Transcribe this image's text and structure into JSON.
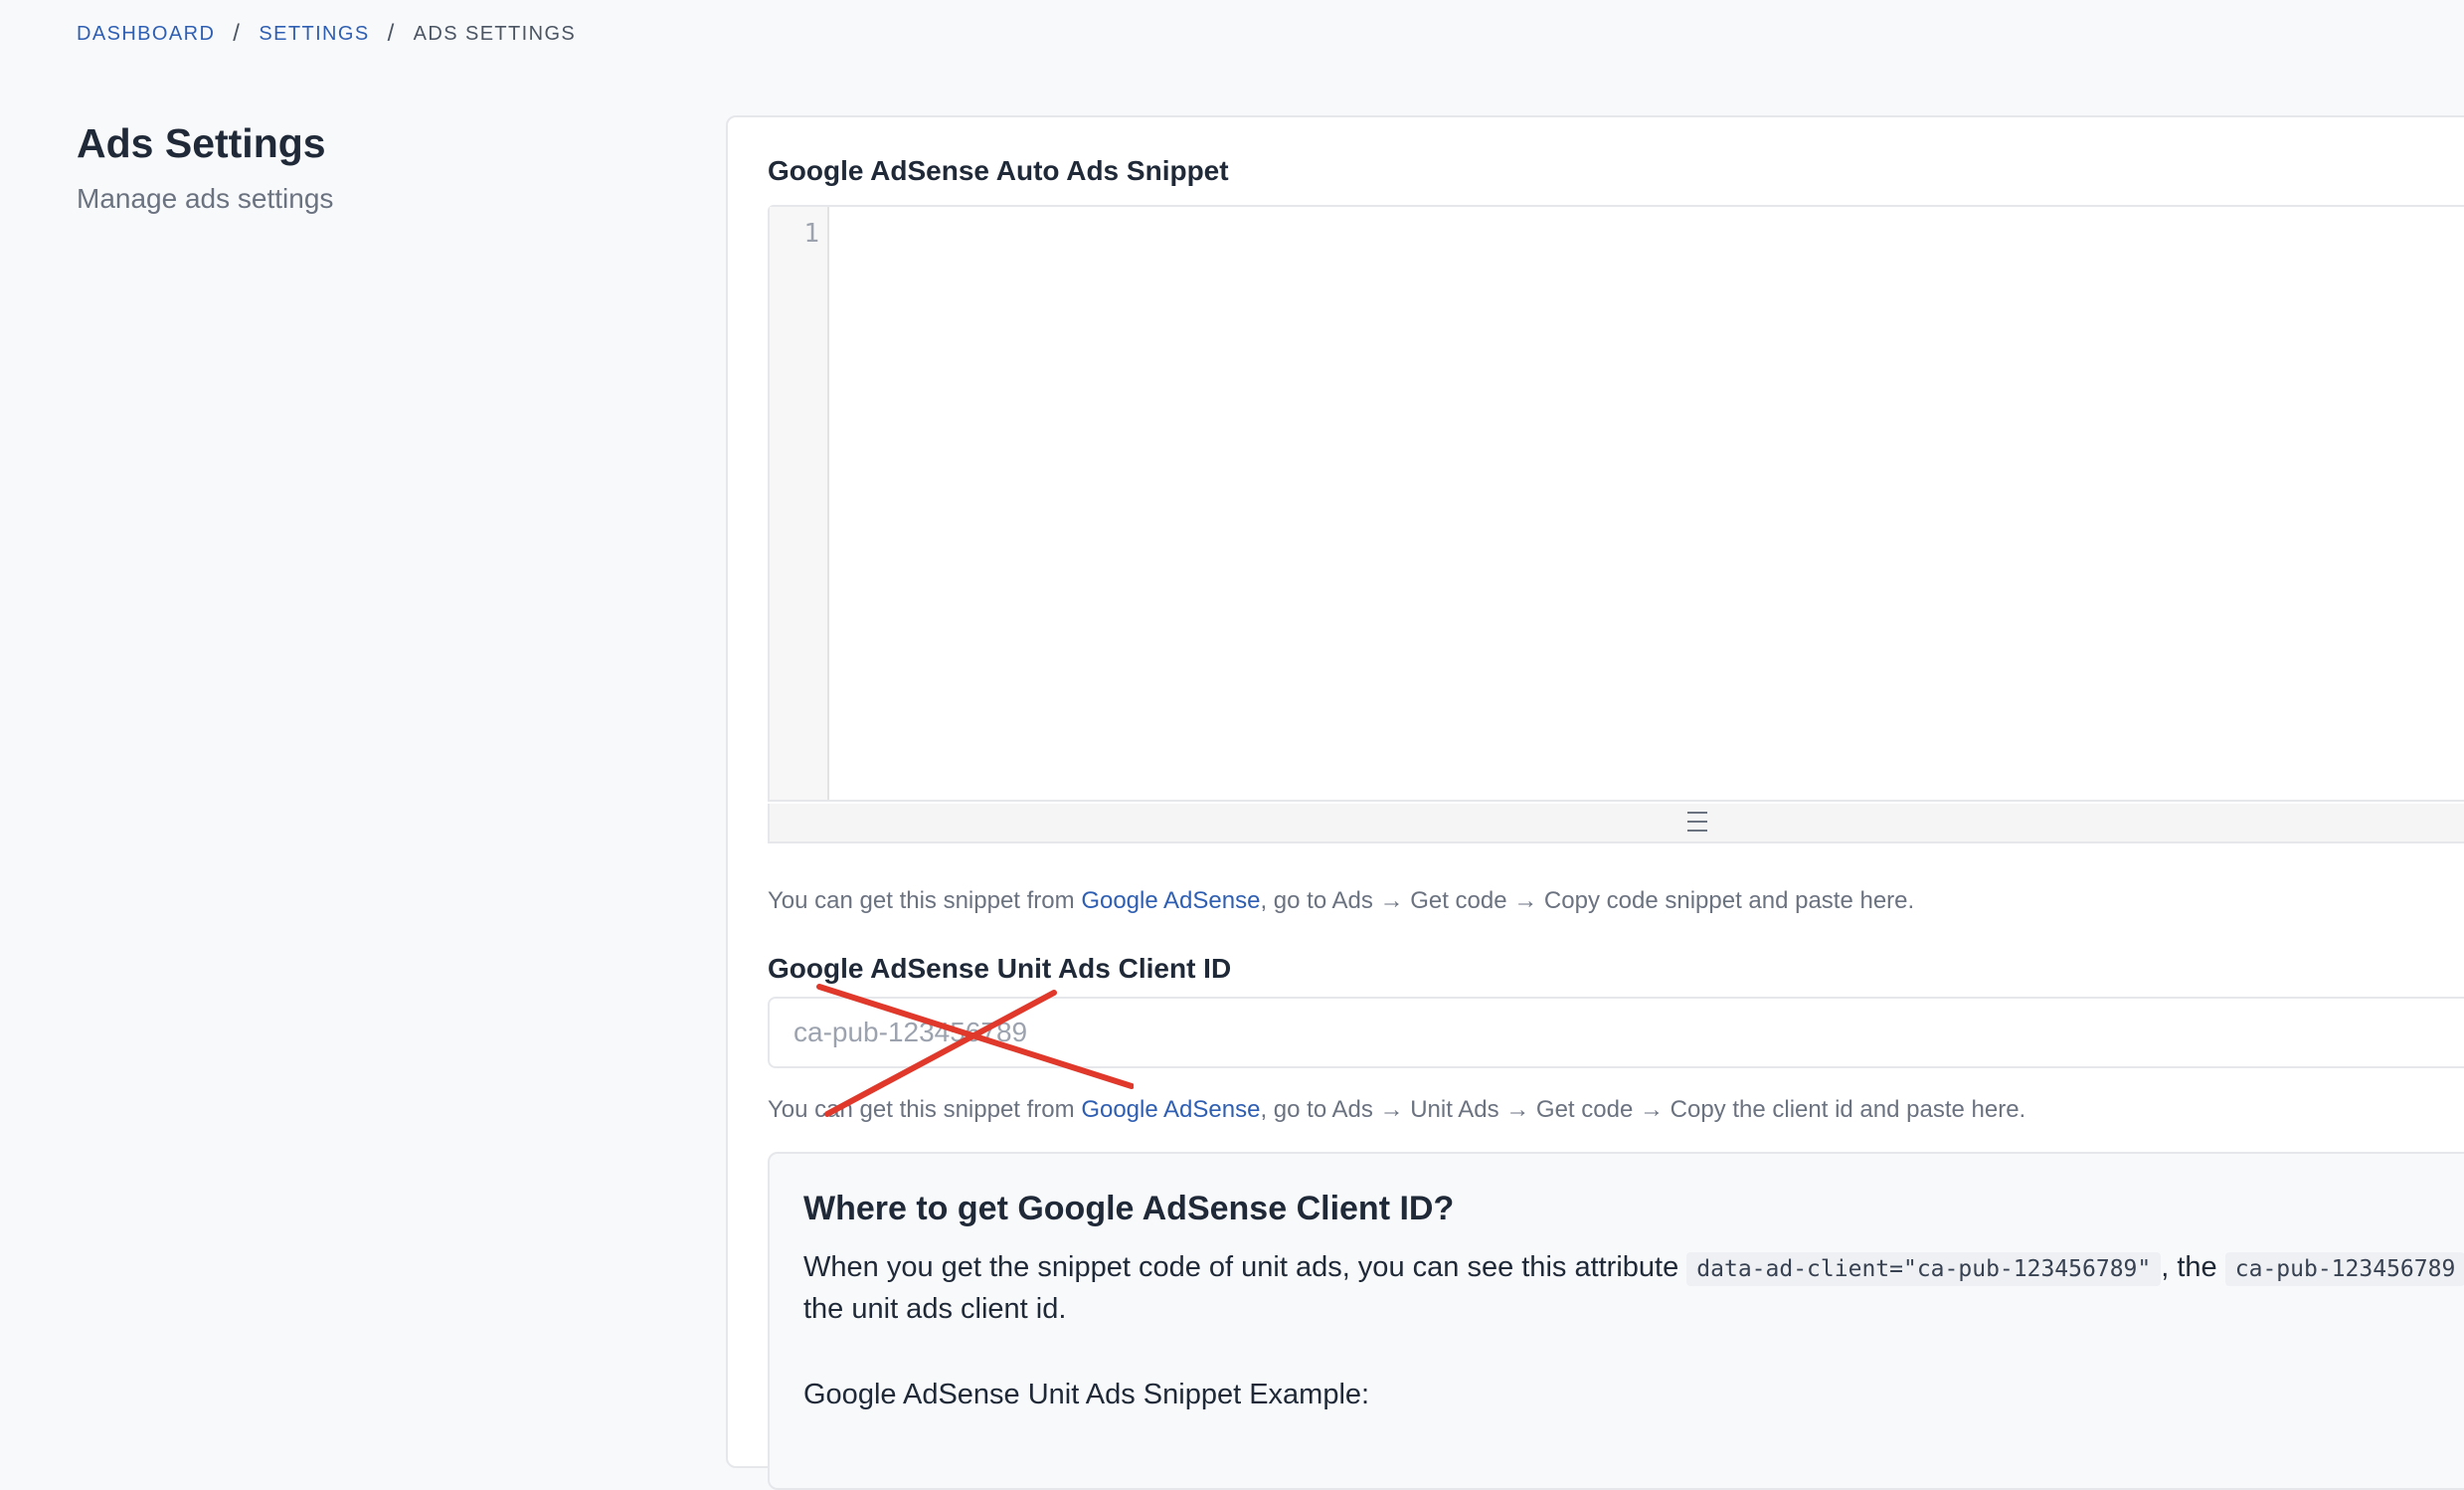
{
  "breadcrumb": {
    "items": [
      "DASHBOARD",
      "SETTINGS"
    ],
    "separator": "/",
    "current": "ADS SETTINGS"
  },
  "page": {
    "title": "Ads Settings",
    "subtitle": "Manage ads settings"
  },
  "auto_ads": {
    "label": "Google AdSense Auto Ads Snippet",
    "line_number": "1",
    "code_value": "",
    "help_prefix": "You can get this snippet from ",
    "help_link": "Google AdSense",
    "help_suffix": ", go to Ads → Get code → Copy code snippet and paste here."
  },
  "unit_ads": {
    "label": "Google AdSense Unit Ads Client ID",
    "placeholder": "ca-pub-123456789",
    "value": "",
    "help_prefix": "You can get this snippet from ",
    "help_link": "Google AdSense",
    "help_suffix": ", go to Ads → Unit Ads → Get code → Copy the client id and paste here."
  },
  "info": {
    "title": "Where to get Google AdSense Client ID?",
    "para_prefix": "When you get the snippet code of unit ads, you can see this attribute ",
    "attr_code": "data-ad-client=\"ca-pub-123456789\"",
    "para_middle": ", the ",
    "client_code": "ca-pub-123456789",
    "para_suffix": " is the unit ads client id.",
    "example_label": "Google AdSense Unit Ads Snippet Example:"
  },
  "colors": {
    "link": "#2f5fb3",
    "annotation_cross": "#e0382b",
    "page_background": "#f8f9fb"
  },
  "icons": {
    "resize_handle": "hamburger-icon",
    "annotation": "red-x-mark"
  }
}
